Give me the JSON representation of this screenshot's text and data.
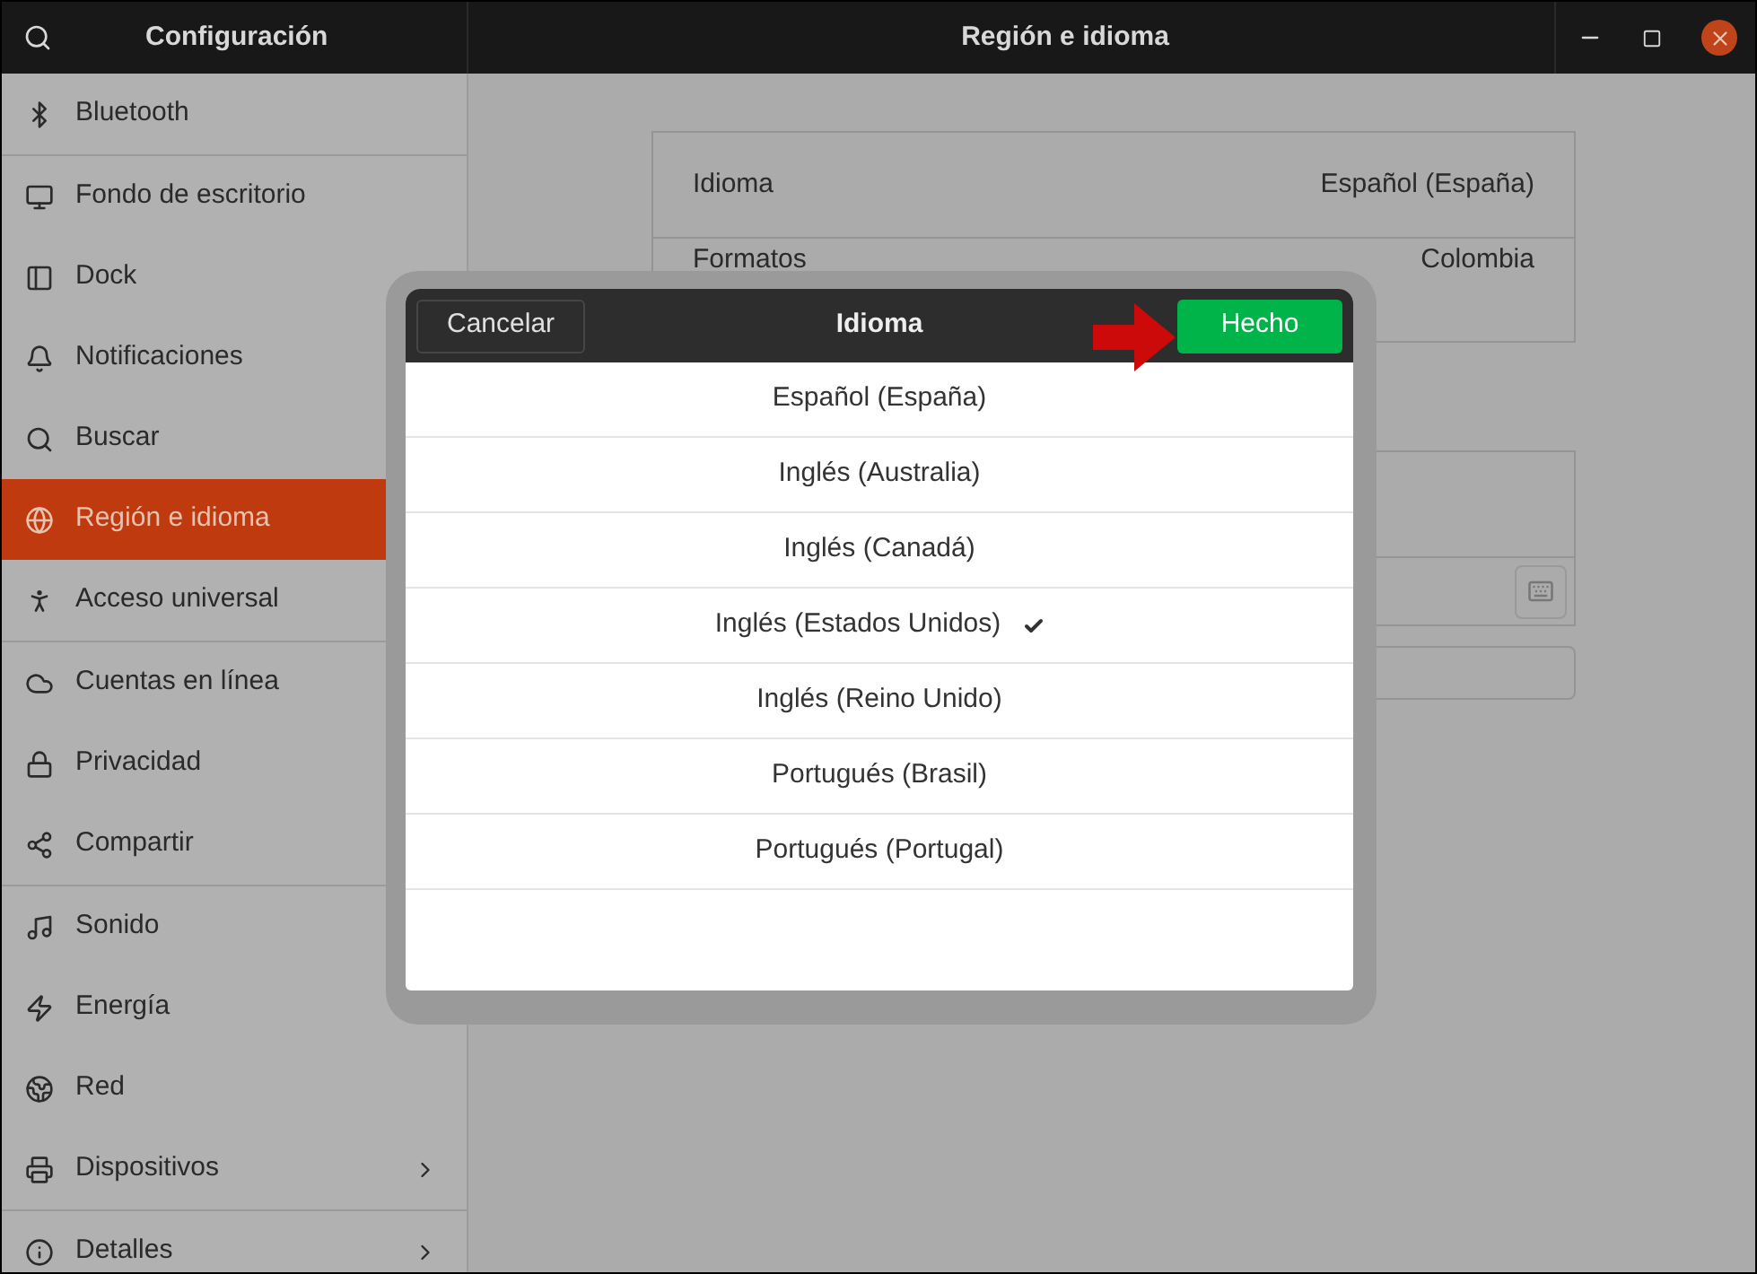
{
  "window": {
    "sidebar_title": "Configuración",
    "title": "Región e idioma"
  },
  "sidebar": {
    "groups": [
      [
        {
          "label": "Bluetooth",
          "selected": false
        }
      ],
      [
        {
          "label": "Fondo de escritorio",
          "selected": false
        },
        {
          "label": "Dock",
          "selected": false
        },
        {
          "label": "Notificaciones",
          "selected": false
        },
        {
          "label": "Buscar",
          "selected": false
        },
        {
          "label": "Región e idioma",
          "selected": true
        },
        {
          "label": "Acceso universal",
          "selected": false
        }
      ],
      [
        {
          "label": "Cuentas en línea",
          "selected": false
        },
        {
          "label": "Privacidad",
          "selected": false
        },
        {
          "label": "Compartir",
          "selected": false
        }
      ],
      [
        {
          "label": "Sonido",
          "selected": false
        },
        {
          "label": "Energía",
          "selected": false
        },
        {
          "label": "Red",
          "selected": false
        },
        {
          "label": "Dispositivos",
          "selected": false,
          "chevron": true
        }
      ],
      [
        {
          "label": "Detalles",
          "selected": false,
          "chevron": true
        }
      ]
    ]
  },
  "settings": [
    {
      "label": "Idioma",
      "value": "Español (España)"
    },
    {
      "label": "Formatos",
      "value": "Colombia"
    }
  ],
  "dialog": {
    "title": "Idioma",
    "cancel": "Cancelar",
    "done": "Hecho",
    "languages": [
      {
        "label": "Español (España)",
        "selected": false
      },
      {
        "label": "Inglés (Australia)",
        "selected": false
      },
      {
        "label": "Inglés (Canadá)",
        "selected": false
      },
      {
        "label": "Inglés (Estados Unidos)",
        "selected": true
      },
      {
        "label": "Inglés (Reino Unido)",
        "selected": false
      },
      {
        "label": "Portugués (Brasil)",
        "selected": false
      },
      {
        "label": "Portugués (Portugal)",
        "selected": false
      }
    ]
  }
}
